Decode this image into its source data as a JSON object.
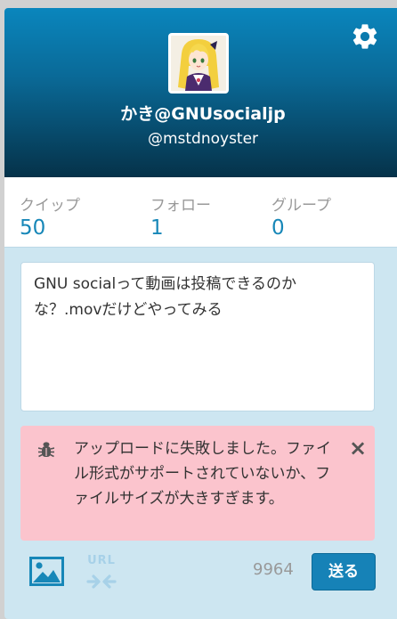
{
  "profile": {
    "display_name": "かき@GNUsocialjp",
    "handle": "@mstdnoyster"
  },
  "stats": [
    {
      "label": "クイップ",
      "value": "50"
    },
    {
      "label": "フォロー",
      "value": "1"
    },
    {
      "label": "グループ",
      "value": "0"
    }
  ],
  "composer": {
    "text": "GNU socialって動画は投稿できるのかな？.movだけどやってみる",
    "char_counter": "9964",
    "send_label": "送る",
    "url_label": "URL"
  },
  "alert": {
    "message": "アップロードに失敗しました。ファイル形式がサポートされていないか、ファイルサイズが大きすぎます。",
    "close_glyph": "×"
  },
  "colors": {
    "header_top": "#0a86bd",
    "header_bottom": "#053249",
    "accent": "#1682b7",
    "alert_bg": "#fbc4cd",
    "panel_bg": "#cde6f1"
  },
  "icons": [
    "gear-icon",
    "avatar",
    "bug-icon",
    "image-icon",
    "url-arrows-icon"
  ]
}
